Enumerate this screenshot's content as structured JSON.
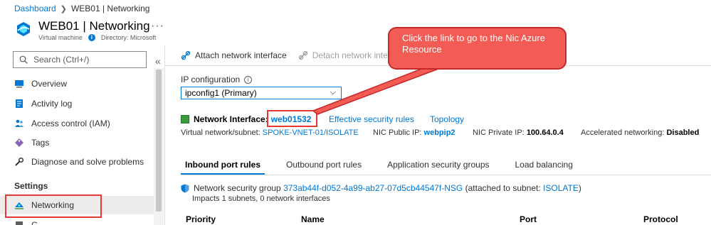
{
  "breadcrumb": {
    "home": "Dashboard",
    "current": "WEB01 | Networking"
  },
  "header": {
    "title": "WEB01 | Networking",
    "subtitle": "Virtual machine",
    "directory": "Directory: Microsoft"
  },
  "sidebar": {
    "search_placeholder": "Search (Ctrl+/)",
    "items": [
      {
        "label": "Overview",
        "icon": "monitor-icon"
      },
      {
        "label": "Activity log",
        "icon": "log-icon"
      },
      {
        "label": "Access control (IAM)",
        "icon": "people-icon"
      },
      {
        "label": "Tags",
        "icon": "tag-icon"
      },
      {
        "label": "Diagnose and solve problems",
        "icon": "wrench-icon"
      }
    ],
    "section": "Settings",
    "active_item": "Networking",
    "partial_item": "C"
  },
  "toolbar": {
    "attach": "Attach network interface",
    "detach": "Detach network interface"
  },
  "ip_config": {
    "label": "IP configuration",
    "selected": "ipconfig1 (Primary)"
  },
  "nic": {
    "label": "Network Interface:",
    "name": "web01532",
    "effective_rules": "Effective security rules",
    "topology": "Topology"
  },
  "info": {
    "vnet_label": "Virtual network/subnet:",
    "vnet_value": "SPOKE-VNET-01/ISOLATE",
    "pubip_label": "NIC Public IP:",
    "pubip_value": "webpip2",
    "privip_label": "NIC Private IP:",
    "privip_value": "100.64.0.4",
    "accel_label": "Accelerated networking:",
    "accel_value": "Disabled"
  },
  "tabs": [
    "Inbound port rules",
    "Outbound port rules",
    "Application security groups",
    "Load balancing"
  ],
  "nsg": {
    "label": "Network security group",
    "name": "373ab44f-d052-4a99-ab27-07d5cb44547f-NSG",
    "attached_prefix": "(attached to subnet:",
    "subnet": "ISOLATE",
    "attached_suffix": ")",
    "impacts": "Impacts 1 subnets, 0 network interfaces"
  },
  "table_headers": [
    "Priority",
    "Name",
    "Port",
    "Protocol"
  ],
  "callout": {
    "text": "Click the link to go to the Nic Azure Resource"
  },
  "colors": {
    "accent": "#0078d4",
    "highlight": "#e53935",
    "callout": "#f25c54"
  }
}
